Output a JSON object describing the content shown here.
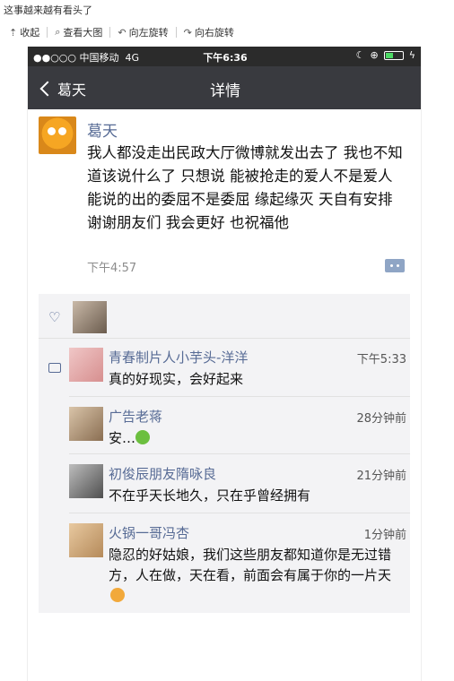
{
  "page": {
    "title": "这事越来越有看头了"
  },
  "toolbar": {
    "items": [
      {
        "label": "收起",
        "icon": "upload-arrow-icon"
      },
      {
        "label": "查看大图",
        "icon": "magnifier-icon"
      },
      {
        "label": "向左旋转",
        "icon": "rotate-left-icon"
      },
      {
        "label": "向右旋转",
        "icon": "rotate-right-icon"
      }
    ]
  },
  "statusbar": {
    "signal": "●●○○○",
    "carrier": "中国移动",
    "network": "4G",
    "time": "下午6:36",
    "battery_level": 0.45
  },
  "navbar": {
    "back_label": "葛天",
    "title": "详情"
  },
  "post": {
    "author": "葛天",
    "text": "我人都没走出民政大厅微博就发出去了 我也不知道该说什么了 只想说 能被抢走的爱人不是爱人 能说的出的委屈不是委屈 缘起缘灭 天自有安排 谢谢朋友们 我会更好 也祝福他",
    "time": "下午4:57"
  },
  "comments": [
    {
      "name": "青春制片人小芋头-洋洋",
      "time": "下午5:33",
      "text": "真的好现实，会好起来"
    },
    {
      "name": "广告老蒋",
      "time": "28分钟前",
      "text": "安…"
    },
    {
      "name": "初俊辰朋友隋咏良",
      "time": "21分钟前",
      "text": "不在乎天长地久，只在乎曾经拥有"
    },
    {
      "name": "火锅一哥冯杏",
      "time": "1分钟前",
      "text": "隐忍的好姑娘，我们这些朋友都知道你是无过错方，人在做，天在看，前面会有属于你的一片天"
    }
  ],
  "colors": {
    "nav_bg": "#393a3f",
    "link": "#576b95",
    "comment_bg": "#f3f3f5"
  }
}
